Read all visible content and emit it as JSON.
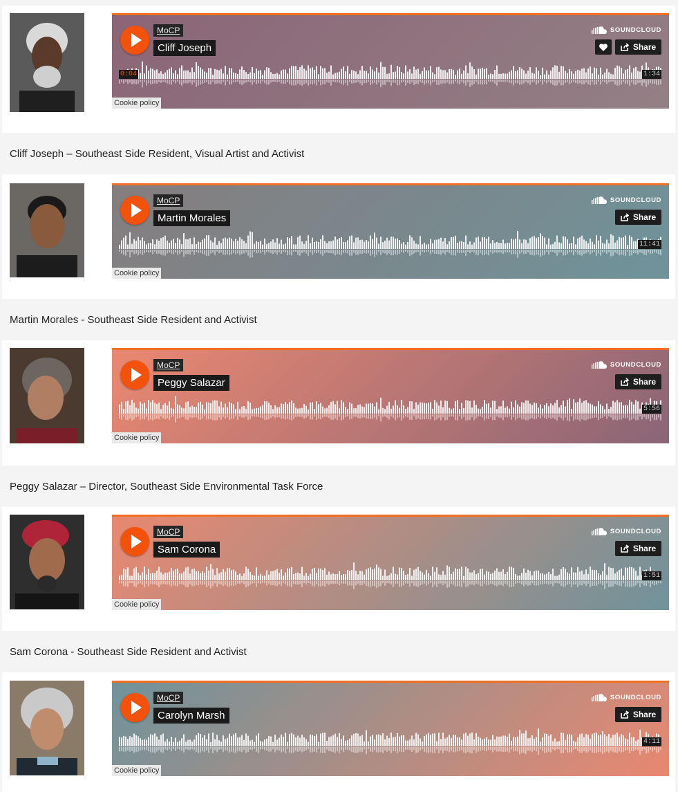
{
  "labels": {
    "user": "MoCP",
    "brand": "SOUNDCLOUD",
    "share": "Share",
    "cookie": "Cookie policy"
  },
  "entries": [
    {
      "person": "Cliff Joseph",
      "track_title": "Cliff Joseph",
      "caption": "Cliff Joseph – Southeast Side Resident, Visual Artist and Activist",
      "current_time": "0:04",
      "duration": "1:34",
      "liked_button": true,
      "gradient": [
        "#8b6577",
        "#938085"
      ]
    },
    {
      "person": "Martin Morales",
      "track_title": "Martin Morales",
      "caption": "Martin Morales - Southeast Side Resident and Activist",
      "duration": "11:41",
      "gradient": [
        "#857d7e",
        "#6f939b"
      ]
    },
    {
      "person": "Peggy Salazar",
      "track_title": "Peggy Salazar",
      "caption": "Peggy Salazar – Director, Southeast Side Environmental Task Force",
      "duration": "5:56",
      "gradient": [
        "#ea8870",
        "#8a6577"
      ]
    },
    {
      "person": "Sam Corona",
      "track_title": "Sam Corona",
      "caption": "Sam Corona - Southeast Side Resident and Activist",
      "duration": "1:51",
      "gradient": [
        "#e98870",
        "#6f939b"
      ]
    },
    {
      "person": "Carolyn Marsh",
      "track_title": "Carolyn Marsh",
      "caption": "",
      "duration": "4:11",
      "gradient": [
        "#6f939b",
        "#e98870"
      ]
    }
  ]
}
